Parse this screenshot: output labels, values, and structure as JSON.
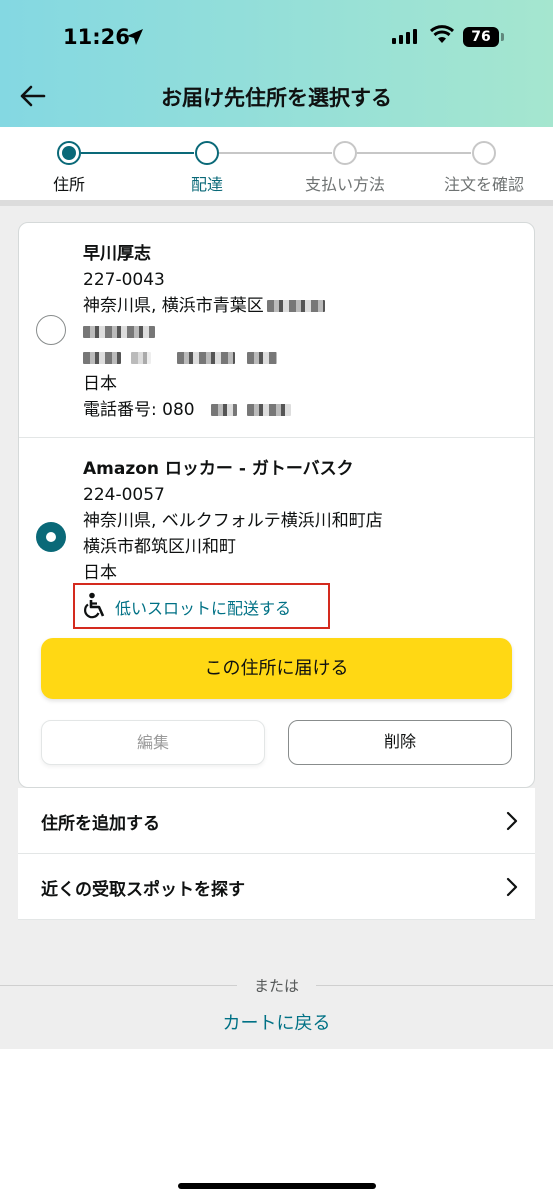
{
  "status_bar": {
    "time": "11:26",
    "battery": "76"
  },
  "header": {
    "title": "お届け先住所を選択する"
  },
  "steps": [
    {
      "label": "住所",
      "state": "active"
    },
    {
      "label": "配達",
      "state": "next"
    },
    {
      "label": "支払い方法",
      "state": "todo"
    },
    {
      "label": "注文を確認",
      "state": "todo"
    }
  ],
  "addresses": [
    {
      "name": "早川厚志",
      "postal": "227-0043",
      "line1": "神奈川県, 横浜市青葉区",
      "country": "日本",
      "phone": "電話番号: 080",
      "selected": false
    },
    {
      "name": "Amazon ロッカー - ガトーバスク",
      "postal": "224-0057",
      "line1": "神奈川県, ベルクフォルテ横浜川和町店",
      "line2": "横浜市都筑区川和町",
      "country": "日本",
      "selected": true,
      "accessibility_link": "低いスロットに配送する"
    }
  ],
  "actions": {
    "deliver": "この住所に届ける",
    "edit": "編集",
    "delete": "削除"
  },
  "menu": [
    {
      "label": "住所を追加する"
    },
    {
      "label": "近くの受取スポットを探す"
    }
  ],
  "footer": {
    "or": "または",
    "back_to_cart": "カートに戻る"
  },
  "colors": {
    "accent": "#0a6978",
    "link": "#007185",
    "primary_button": "#ffd814",
    "highlight_box": "#d42a1e"
  }
}
